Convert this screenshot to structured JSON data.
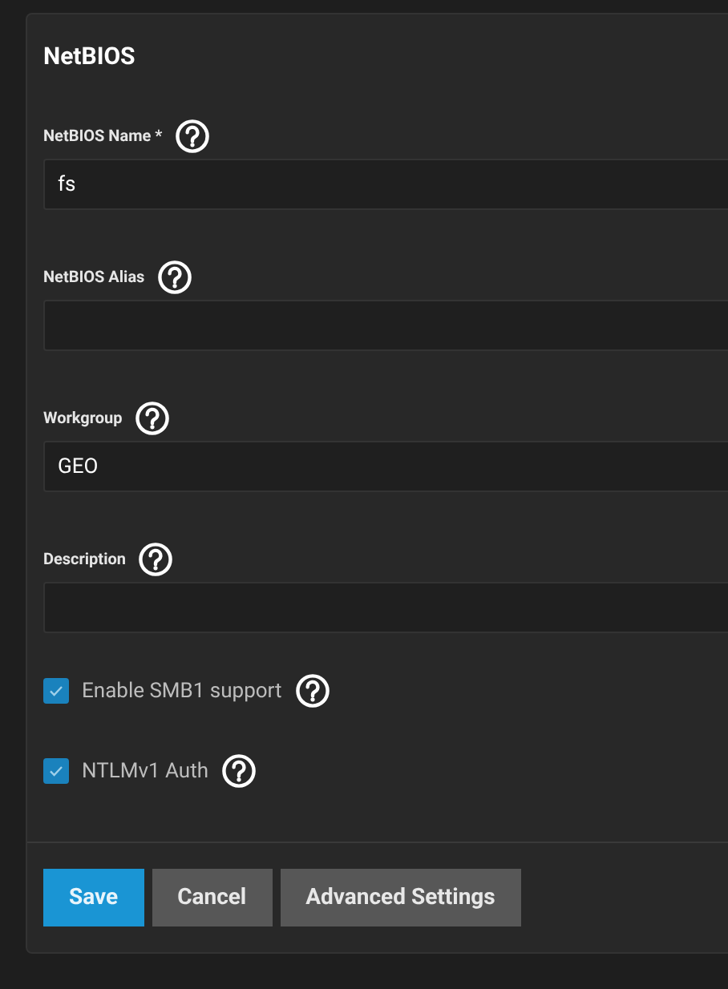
{
  "card": {
    "title": "NetBIOS"
  },
  "fields": [
    {
      "label": "NetBIOS Name *",
      "value": "fs"
    },
    {
      "label": "NetBIOS Alias"
    },
    {
      "label": "Workgroup",
      "value": "GEO"
    },
    {
      "label": "Description"
    }
  ],
  "checkboxes": [
    {
      "label": "Enable SMB1 support",
      "checked": true
    },
    {
      "label": "NTLMv1 Auth",
      "checked": true
    }
  ],
  "buttons": [
    {
      "label": "Save",
      "kind": "primary"
    },
    {
      "label": "Cancel",
      "kind": "secondary"
    },
    {
      "label": "Advanced Settings",
      "kind": "secondary"
    }
  ]
}
